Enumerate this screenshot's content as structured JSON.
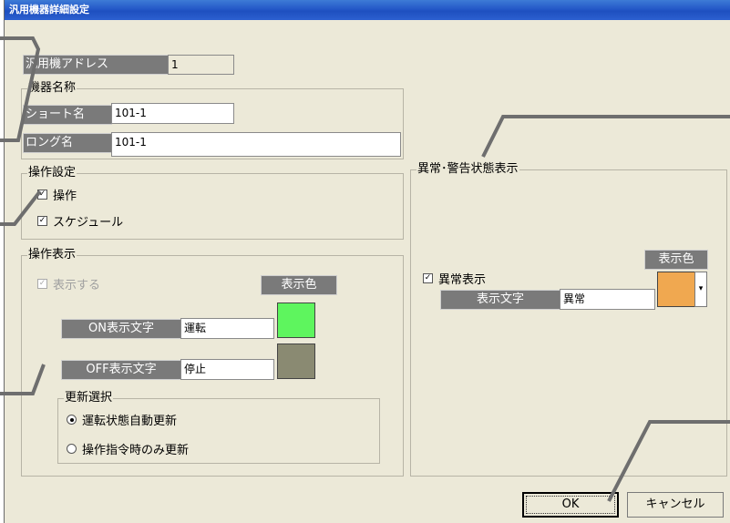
{
  "window": {
    "title": "汎用機器詳細設定"
  },
  "address": {
    "label": "汎用機アドレス",
    "value": "1"
  },
  "device_name": {
    "legend": "機器名称",
    "short_label": "ショート名",
    "short_value": "101-1",
    "long_label": "ロング名",
    "long_value": "101-1"
  },
  "operation_settings": {
    "legend": "操作設定",
    "operate_label": "操作",
    "operate_checked": true,
    "schedule_label": "スケジュール",
    "schedule_checked": true
  },
  "operation_display": {
    "legend": "操作表示",
    "show_label": "表示する",
    "color_button": "表示色",
    "on_label": "ON表示文字",
    "on_value": "運転",
    "on_color": "#5ef55e",
    "off_label": "OFF表示文字",
    "off_value": "停止",
    "off_color": "#8a8a72",
    "update": {
      "legend": "更新選択",
      "option_auto": "運転状態自動更新",
      "option_manual": "操作指令時のみ更新",
      "selected": "auto"
    }
  },
  "alarm_display": {
    "legend": "異常･警告状態表示",
    "color_label": "表示色",
    "alarm_label": "異常表示",
    "alarm_checked": true,
    "text_label": "表示文字",
    "text_value": "異常",
    "color": "#f0a850"
  },
  "buttons": {
    "ok": "OK",
    "cancel": "キャンセル"
  },
  "icons": {
    "check": "✓",
    "dropdown": "▾"
  },
  "callout_color": "#6e6e6e"
}
